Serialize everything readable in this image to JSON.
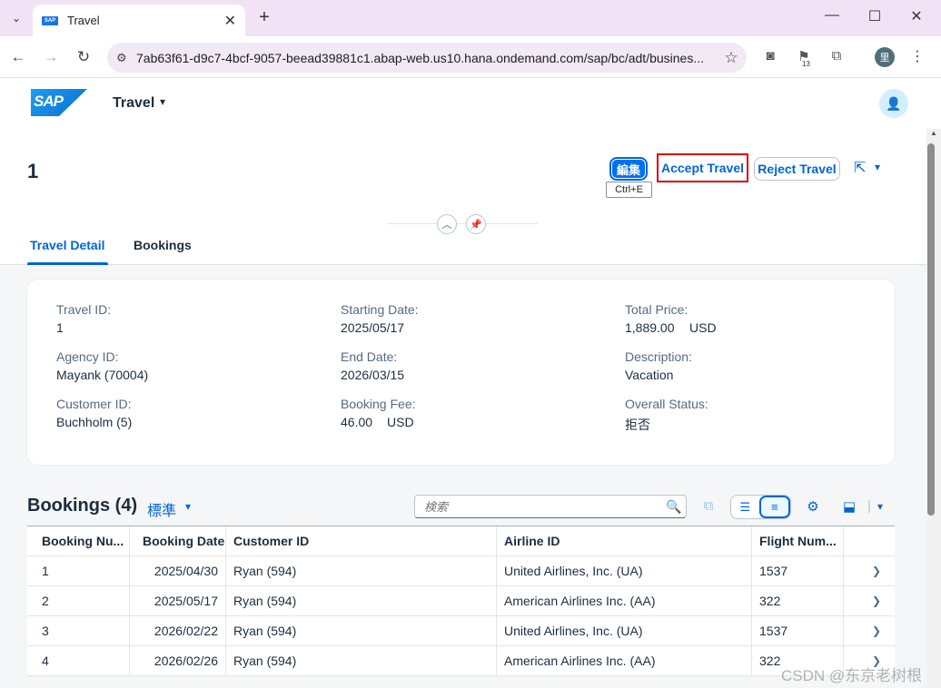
{
  "browser": {
    "tab_title": "Travel",
    "favicon_text": "SAP",
    "url": "7ab63f61-d9c7-4bcf-9057-beead39881c1.abap-web.us10.hana.ondemand.com/sap/bc/adt/busines...",
    "extension_badge": "13",
    "profile_initial": "里"
  },
  "shell": {
    "logo_text": "SAP",
    "app_title": "Travel"
  },
  "header": {
    "object_title": "1",
    "edit_label": "編集",
    "edit_tooltip": "Ctrl+E",
    "accept_label": "Accept Travel",
    "reject_label": "Reject Travel"
  },
  "tabs": [
    {
      "label": "Travel Detail"
    },
    {
      "label": "Bookings"
    }
  ],
  "details": {
    "travel_id_label": "Travel ID:",
    "travel_id": "1",
    "agency_id_label": "Agency ID:",
    "agency_id": "Mayank (70004)",
    "customer_id_label": "Customer ID:",
    "customer_id": "Buchholm (5)",
    "starting_date_label": "Starting Date:",
    "starting_date": "2025/05/17",
    "end_date_label": "End Date:",
    "end_date": "2026/03/15",
    "booking_fee_label": "Booking Fee:",
    "booking_fee": "46.00",
    "booking_fee_currency": "USD",
    "total_price_label": "Total Price:",
    "total_price": "1,889.00",
    "total_price_currency": "USD",
    "description_label": "Description:",
    "description": "Vacation",
    "overall_status_label": "Overall Status:",
    "overall_status": "拒否"
  },
  "bookings": {
    "title": "Bookings (4)",
    "variant": "標準",
    "search_placeholder": "検索",
    "columns": [
      "Booking Nu...",
      "Booking Date",
      "Customer ID",
      "Airline ID",
      "Flight Num..."
    ],
    "rows": [
      {
        "num": "1",
        "date": "2025/04/30",
        "customer": "Ryan (594)",
        "airline": "United Airlines, Inc. (UA)",
        "flight": "1537"
      },
      {
        "num": "2",
        "date": "2025/05/17",
        "customer": "Ryan (594)",
        "airline": "American Airlines Inc. (AA)",
        "flight": "322"
      },
      {
        "num": "3",
        "date": "2026/02/22",
        "customer": "Ryan (594)",
        "airline": "United Airlines, Inc. (UA)",
        "flight": "1537"
      },
      {
        "num": "4",
        "date": "2026/02/26",
        "customer": "Ryan (594)",
        "airline": "American Airlines Inc. (AA)",
        "flight": "322"
      }
    ]
  },
  "watermark": "CSDN @东京老树根",
  "colors": {
    "accent": "#0064d9",
    "highlight": "#d9000e"
  }
}
